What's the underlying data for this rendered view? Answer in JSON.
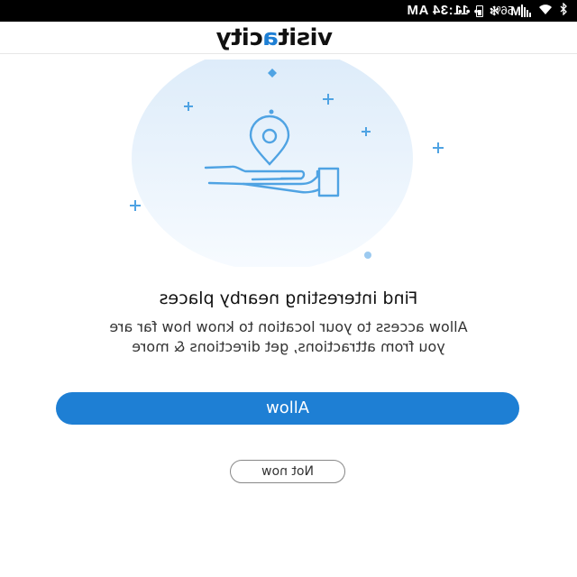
{
  "status_bar": {
    "time": "11:34 AM",
    "battery": "56%",
    "icons": [
      "more-icon",
      "fan-icon",
      "gmail-icon",
      "wifi-icon",
      "bluetooth-icon",
      "signal-icon",
      "battery-icon"
    ]
  },
  "header": {
    "logo_part1": "visit",
    "logo_accent": "a",
    "logo_part2": "city"
  },
  "content": {
    "heading": "Find interesting nearby places",
    "description_line1": "Allow access to your location to know how far are",
    "description_line2": "you from attractions, get directions & more"
  },
  "actions": {
    "allow_label": "Allow",
    "not_now_label": "Not now"
  },
  "colors": {
    "accent": "#1e7fd4",
    "illustration_bg": "#e6f1fb",
    "sparkle": "#4fa3e3"
  }
}
